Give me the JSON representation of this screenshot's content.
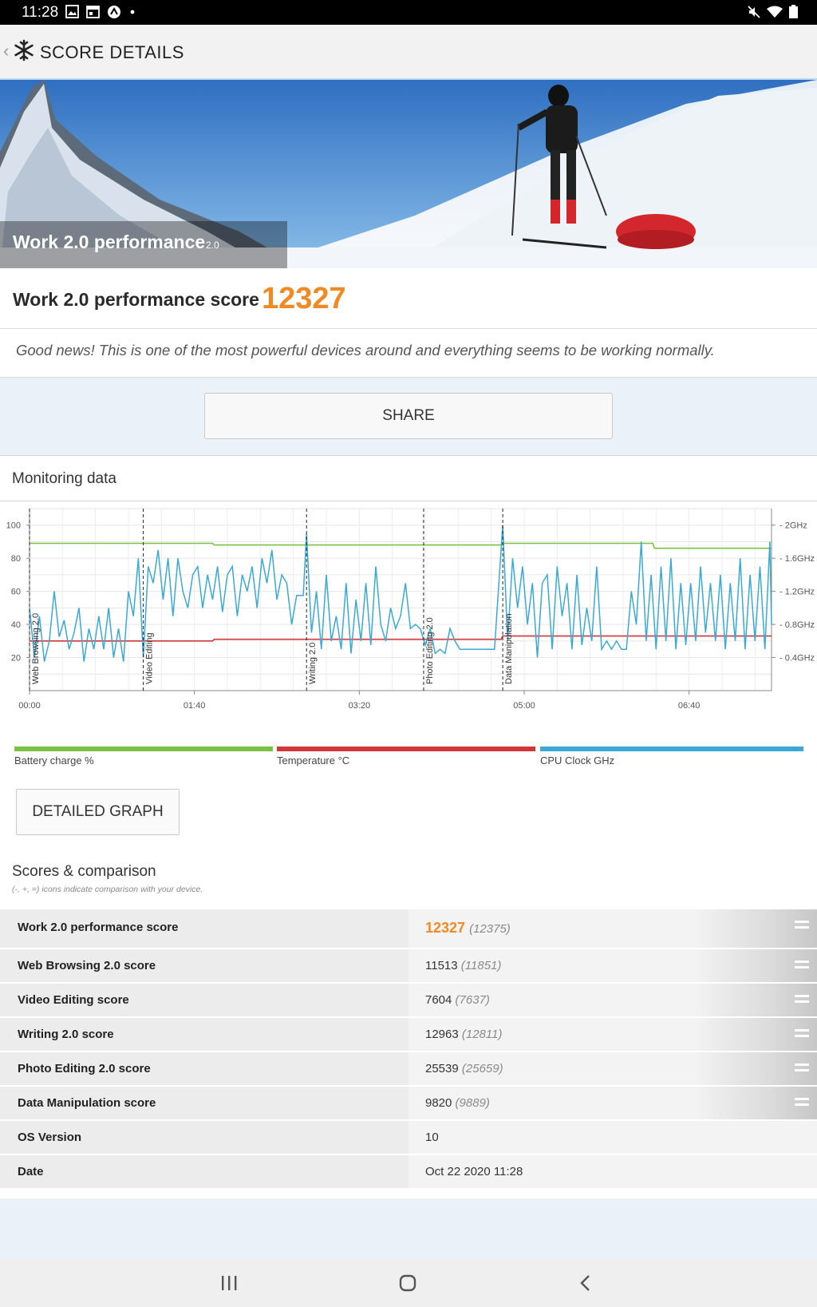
{
  "status_bar": {
    "time": "11:28"
  },
  "app_bar": {
    "title": "SCORE DETAILS"
  },
  "hero": {
    "title": "Work 2.0 performance",
    "version": "2.0"
  },
  "score": {
    "label": "Work 2.0 performance score",
    "value": "12327",
    "message": "Good news! This is one of the most powerful devices around and everything seems to be working normally."
  },
  "share_label": "SHARE",
  "monitoring": {
    "title": "Monitoring data",
    "detailed_label": "DETAILED GRAPH",
    "legend": [
      {
        "label": "Battery charge %",
        "color": "#7cc142"
      },
      {
        "label": "Temperature °C",
        "color": "#d0363a"
      },
      {
        "label": "CPU Clock GHz",
        "color": "#3aa9d6"
      }
    ]
  },
  "chart_data": {
    "type": "line",
    "x_ticks": [
      "00:00",
      "01:40",
      "03:20",
      "05:00",
      "06:40"
    ],
    "y_left_ticks": [
      "100",
      "80",
      "60",
      "40",
      "20"
    ],
    "y_right_ticks": [
      "2GHz",
      "1.6GHz",
      "1.2GHz",
      "0.8GHz",
      "0.4GHz"
    ],
    "x_range_s": [
      0,
      450
    ],
    "y_left_range": [
      0,
      110
    ],
    "y_right_range_ghz": [
      0,
      2.2
    ],
    "segments": [
      {
        "label": "Web Browsing 2.0",
        "start_s": 0
      },
      {
        "label": "Video Editing",
        "start_s": 69
      },
      {
        "label": "Writing 2.0",
        "start_s": 168
      },
      {
        "label": "Photo Editing 2.0",
        "start_s": 239
      },
      {
        "label": "Data Manipulation",
        "start_s": 287
      }
    ],
    "series": [
      {
        "name": "Battery charge %",
        "points": [
          [
            0,
            89
          ],
          [
            111,
            89
          ],
          [
            112,
            88
          ],
          [
            168,
            88
          ],
          [
            286,
            88
          ],
          [
            287,
            89
          ],
          [
            378,
            89
          ],
          [
            379,
            86
          ],
          [
            450,
            86
          ]
        ]
      },
      {
        "name": "Temperature °C",
        "points": [
          [
            0,
            30
          ],
          [
            111,
            30
          ],
          [
            112,
            31
          ],
          [
            168,
            31
          ],
          [
            286,
            31
          ],
          [
            287,
            33
          ],
          [
            450,
            33
          ]
        ]
      },
      {
        "name": "CPU Clock GHz",
        "points": [
          [
            0,
            1.0
          ],
          [
            3,
            0.4
          ],
          [
            6,
            0.9
          ],
          [
            9,
            0.35
          ],
          [
            12,
            0.6
          ],
          [
            15,
            1.2
          ],
          [
            18,
            0.65
          ],
          [
            21,
            0.85
          ],
          [
            24,
            0.5
          ],
          [
            27,
            0.7
          ],
          [
            30,
            1.0
          ],
          [
            33,
            0.35
          ],
          [
            36,
            0.75
          ],
          [
            39,
            0.5
          ],
          [
            42,
            0.9
          ],
          [
            45,
            0.5
          ],
          [
            48,
            1.0
          ],
          [
            51,
            0.4
          ],
          [
            54,
            0.75
          ],
          [
            57,
            0.35
          ],
          [
            60,
            1.2
          ],
          [
            63,
            0.9
          ],
          [
            66,
            1.6
          ],
          [
            69,
            0.4
          ],
          [
            72,
            1.5
          ],
          [
            75,
            1.3
          ],
          [
            78,
            1.7
          ],
          [
            81,
            1.1
          ],
          [
            84,
            1.6
          ],
          [
            87,
            0.9
          ],
          [
            90,
            1.6
          ],
          [
            93,
            1.2
          ],
          [
            96,
            1.0
          ],
          [
            99,
            1.4
          ],
          [
            102,
            1.5
          ],
          [
            105,
            1.0
          ],
          [
            108,
            1.4
          ],
          [
            111,
            1.1
          ],
          [
            114,
            1.5
          ],
          [
            117,
            0.95
          ],
          [
            120,
            1.4
          ],
          [
            123,
            1.5
          ],
          [
            126,
            0.9
          ],
          [
            129,
            1.4
          ],
          [
            132,
            1.2
          ],
          [
            135,
            1.5
          ],
          [
            138,
            1.0
          ],
          [
            141,
            1.6
          ],
          [
            144,
            1.3
          ],
          [
            147,
            1.7
          ],
          [
            150,
            1.1
          ],
          [
            153,
            1.4
          ],
          [
            156,
            1.3
          ],
          [
            159,
            0.8
          ],
          [
            162,
            1.15
          ],
          [
            166,
            1.15
          ],
          [
            168,
            1.9
          ],
          [
            171,
            0.7
          ],
          [
            174,
            1.2
          ],
          [
            177,
            0.5
          ],
          [
            180,
            1.4
          ],
          [
            183,
            0.6
          ],
          [
            186,
            0.9
          ],
          [
            189,
            0.5
          ],
          [
            192,
            1.3
          ],
          [
            195,
            0.45
          ],
          [
            198,
            1.1
          ],
          [
            201,
            0.6
          ],
          [
            204,
            1.3
          ],
          [
            207,
            0.55
          ],
          [
            210,
            1.5
          ],
          [
            213,
            0.8
          ],
          [
            216,
            0.6
          ],
          [
            219,
            1.0
          ],
          [
            222,
            0.75
          ],
          [
            225,
            0.9
          ],
          [
            228,
            1.3
          ],
          [
            231,
            0.75
          ],
          [
            234,
            0.8
          ],
          [
            237,
            0.75
          ],
          [
            240,
            0.55
          ],
          [
            243,
            0.75
          ],
          [
            246,
            0.45
          ],
          [
            249,
            0.5
          ],
          [
            252,
            0.45
          ],
          [
            255,
            0.75
          ],
          [
            258,
            0.6
          ],
          [
            261,
            0.5
          ],
          [
            264,
            0.5
          ],
          [
            270,
            0.5
          ],
          [
            276,
            0.5
          ],
          [
            282,
            0.5
          ],
          [
            287,
            2.0
          ],
          [
            290,
            0.6
          ],
          [
            293,
            1.6
          ],
          [
            296,
            1.0
          ],
          [
            299,
            1.5
          ],
          [
            302,
            0.8
          ],
          [
            305,
            1.3
          ],
          [
            308,
            0.4
          ],
          [
            311,
            1.3
          ],
          [
            314,
            1.4
          ],
          [
            317,
            0.5
          ],
          [
            320,
            1.5
          ],
          [
            323,
            0.9
          ],
          [
            326,
            1.3
          ],
          [
            329,
            0.5
          ],
          [
            332,
            1.4
          ],
          [
            335,
            0.55
          ],
          [
            338,
            1.0
          ],
          [
            341,
            0.6
          ],
          [
            344,
            1.5
          ],
          [
            347,
            0.5
          ],
          [
            350,
            0.6
          ],
          [
            353,
            0.5
          ],
          [
            356,
            0.6
          ],
          [
            359,
            0.5
          ],
          [
            362,
            0.5
          ],
          [
            365,
            1.2
          ],
          [
            368,
            0.8
          ],
          [
            371,
            1.8
          ],
          [
            374,
            0.6
          ],
          [
            377,
            1.4
          ],
          [
            380,
            0.5
          ],
          [
            383,
            1.5
          ],
          [
            386,
            0.6
          ],
          [
            389,
            1.6
          ],
          [
            392,
            0.5
          ],
          [
            395,
            1.3
          ],
          [
            398,
            0.55
          ],
          [
            401,
            1.3
          ],
          [
            404,
            0.6
          ],
          [
            407,
            1.5
          ],
          [
            410,
            0.7
          ],
          [
            413,
            1.3
          ],
          [
            416,
            0.6
          ],
          [
            419,
            1.4
          ],
          [
            422,
            0.5
          ],
          [
            425,
            1.3
          ],
          [
            428,
            0.6
          ],
          [
            431,
            1.6
          ],
          [
            434,
            0.5
          ],
          [
            437,
            1.4
          ],
          [
            440,
            0.6
          ],
          [
            443,
            1.5
          ],
          [
            446,
            0.5
          ],
          [
            449,
            1.8
          ],
          [
            450,
            0.8
          ]
        ]
      }
    ]
  },
  "scores": {
    "title": "Scores & comparison",
    "subtitle": "(-, +, =) icons indicate comparison with your device.",
    "rows": [
      {
        "label": "Work 2.0 performance score",
        "value": "12327",
        "compare": "(12375)",
        "indicator": "equal-icon"
      },
      {
        "label": "Web Browsing 2.0 score",
        "value": "11513",
        "compare": "(11851)",
        "indicator": "equal-icon"
      },
      {
        "label": "Video Editing score",
        "value": "7604",
        "compare": "(7637)",
        "indicator": "equal-icon"
      },
      {
        "label": "Writing 2.0 score",
        "value": "12963",
        "compare": "(12811)",
        "indicator": "equal-icon"
      },
      {
        "label": "Photo Editing 2.0 score",
        "value": "25539",
        "compare": "(25659)",
        "indicator": "equal-icon"
      },
      {
        "label": "Data Manipulation score",
        "value": "9820",
        "compare": "(9889)",
        "indicator": "equal-icon"
      },
      {
        "label": "OS Version",
        "value": "10",
        "compare": "",
        "indicator": ""
      },
      {
        "label": "Date",
        "value": "Oct 22 2020 11:28",
        "compare": "",
        "indicator": ""
      }
    ]
  }
}
